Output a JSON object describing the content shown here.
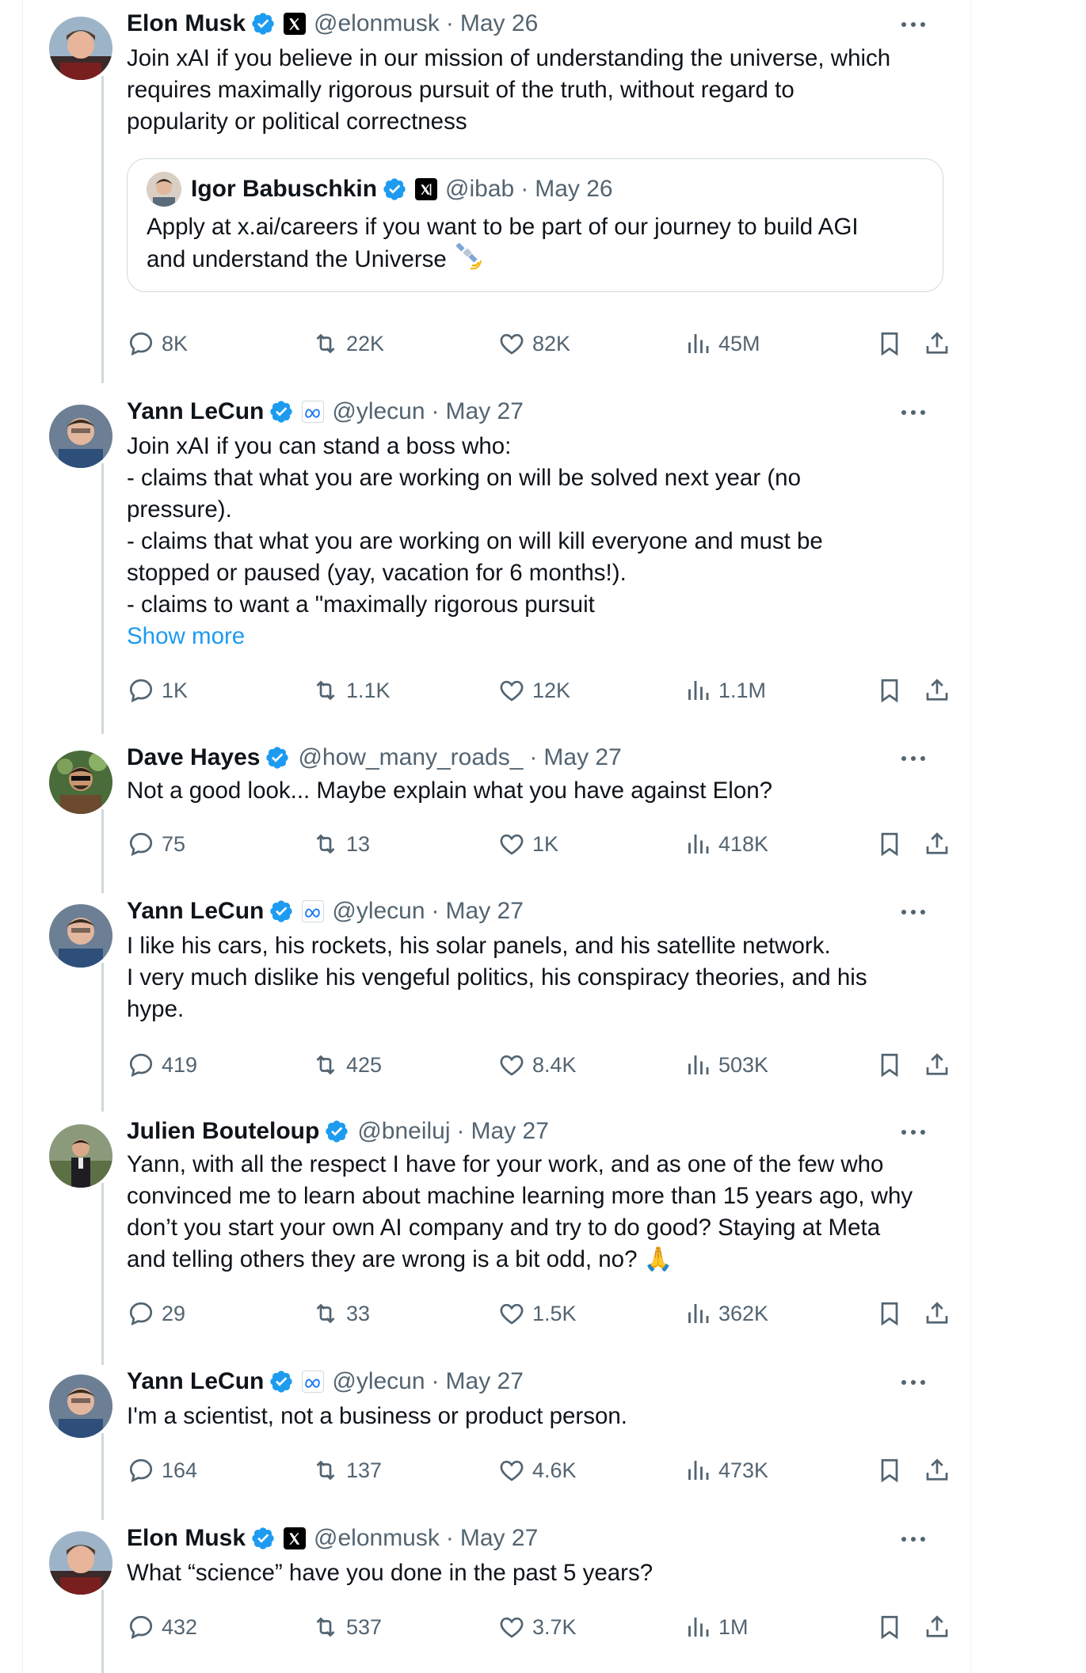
{
  "tweets": [
    {
      "name": "Elon Musk",
      "handle": "@elonmusk",
      "date": "May 26",
      "affiliation": "x",
      "text": "Join xAI if you believe in our mission of understanding the universe, which\nrequires maximally rigorous pursuit of the truth, without regard to\npopularity or political correctness",
      "quote": {
        "name": "Igor Babuschkin",
        "handle": "@ibab",
        "date": "May 26",
        "affiliation": "xai",
        "text": "Apply at x.ai/careers if you want to be part of our journey to build AGI\nand understand the Universe"
      },
      "replies": "8K",
      "retweets": "22K",
      "likes": "82K",
      "views": "45M"
    },
    {
      "name": "Yann LeCun",
      "handle": "@ylecun",
      "date": "May 27",
      "affiliation": "meta",
      "text": "Join xAI if you can stand a boss who:\n- claims that what you are working on will be solved next year (no\npressure).\n- claims that what you are working on will kill everyone and must be\nstopped or paused (yay, vacation for 6 months!).\n- claims to want a \"maximally rigorous pursuit",
      "show_more": "Show more",
      "replies": "1K",
      "retweets": "1.1K",
      "likes": "12K",
      "views": "1.1M"
    },
    {
      "name": "Dave Hayes",
      "handle": "@how_many_roads_",
      "date": "May 27",
      "affiliation": "",
      "text": "Not a good look... Maybe explain what you have against Elon?",
      "replies": "75",
      "retweets": "13",
      "likes": "1K",
      "views": "418K"
    },
    {
      "name": "Yann LeCun",
      "handle": "@ylecun",
      "date": "May 27",
      "affiliation": "meta",
      "text": "I like his cars, his rockets, his solar panels, and his satellite network.\nI very much dislike his vengeful politics, his conspiracy theories, and his\nhype.",
      "replies": "419",
      "retweets": "425",
      "likes": "8.4K",
      "views": "503K"
    },
    {
      "name": "Julien Bouteloup",
      "handle": "@bneiluj",
      "date": "May 27",
      "affiliation": "",
      "text": "Yann, with all the respect I have for your work, and as one of the few who\nconvinced me to learn about machine learning more than 15 years ago, why\ndon’t you start your own AI company and try to do good? Staying at Meta\nand telling others they are wrong is a bit odd, no? 🙏",
      "replies": "29",
      "retweets": "33",
      "likes": "1.5K",
      "views": "362K"
    },
    {
      "name": "Yann LeCun",
      "handle": "@ylecun",
      "date": "May 27",
      "affiliation": "meta",
      "text": "I'm a scientist, not a business or product person.",
      "replies": "164",
      "retweets": "137",
      "likes": "4.6K",
      "views": "473K"
    },
    {
      "name": "Elon Musk",
      "handle": "@elonmusk",
      "date": "May 27",
      "affiliation": "x",
      "text": "What “science” have you done in the past 5 years?",
      "replies": "432",
      "retweets": "537",
      "likes": "3.7K",
      "views": "1M"
    }
  ],
  "colors": {
    "text": "#0f1419",
    "secondary": "#536471",
    "accent": "#1d9bf0",
    "thread_line": "#cfd9de",
    "border": "#eff3f4"
  },
  "icons": [
    "verified-badge-icon",
    "x-logo-icon",
    "meta-logo-icon",
    "xai-logo-icon",
    "more-icon",
    "reply-icon",
    "retweet-icon",
    "like-icon",
    "views-icon",
    "bookmark-icon",
    "share-icon",
    "satellite-emoji"
  ]
}
